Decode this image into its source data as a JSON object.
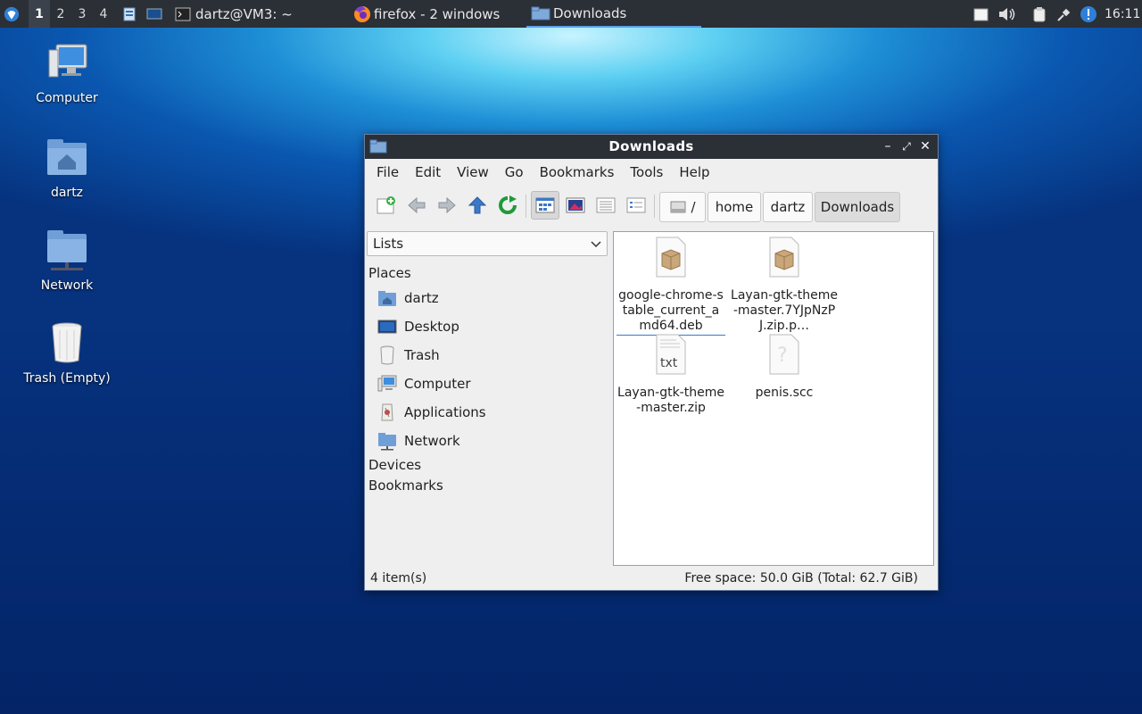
{
  "taskbar": {
    "workspaces": [
      "1",
      "2",
      "3",
      "4"
    ],
    "tasks": {
      "terminal": "dartz@VM3: ~",
      "firefox": "firefox - 2 windows",
      "downloads": "Downloads"
    },
    "clock": "16:11"
  },
  "desktop": {
    "icons": {
      "computer": "Computer",
      "home": "dartz",
      "network": "Network",
      "trash": "Trash (Empty)"
    }
  },
  "window": {
    "title": "Downloads",
    "menu": [
      "File",
      "Edit",
      "View",
      "Go",
      "Bookmarks",
      "Tools",
      "Help"
    ],
    "breadcrumb": [
      "/",
      "home",
      "dartz",
      "Downloads"
    ],
    "side": {
      "select_value": "Lists",
      "places_heading": "Places",
      "places": [
        "dartz",
        "Desktop",
        "Trash",
        "Computer",
        "Applications",
        "Network"
      ],
      "devices_heading": "Devices",
      "bookmarks_heading": "Bookmarks"
    },
    "files": [
      {
        "name": "google-chrome-stable_current_amd64.deb",
        "icon": "package-icon"
      },
      {
        "name": "Layan-gtk-theme-master.7YJpNzPJ.zip.p…",
        "icon": "package-icon"
      },
      {
        "name": "Layan-gtk-theme-master.zip",
        "icon": "text-file-icon"
      },
      {
        "name": "penis.scc",
        "icon": "unknown-file-icon"
      }
    ],
    "status": {
      "count": "4 item(s)",
      "free_space": "Free space: 50.0 GiB (Total: 62.7 GiB)"
    }
  },
  "colors": {
    "taskbar_bg": "#2b2f36",
    "window_bg": "#efefef",
    "accent": "#3c78c8"
  }
}
